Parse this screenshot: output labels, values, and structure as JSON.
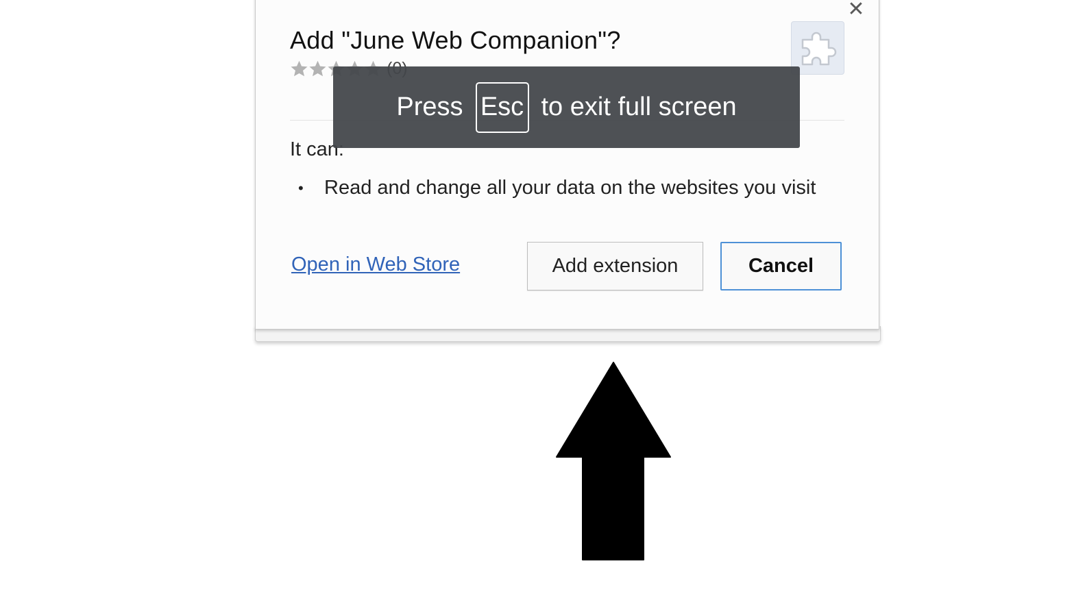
{
  "dialog": {
    "title": "Add \"June Web Companion\"?",
    "rating": {
      "stars_filled": 0,
      "stars_total": 5,
      "count_label": "(0)"
    },
    "icon": "puzzle-piece-icon",
    "close_icon": "close-icon",
    "close_glyph": "✕",
    "permissions_heading": "It can:",
    "permissions": [
      "Read and change all your data on the websites you visit"
    ],
    "bullet": "•",
    "webstore_link_label": "Open in Web Store",
    "add_button_label": "Add extension",
    "cancel_button_label": "Cancel"
  },
  "fullscreen_toast": {
    "prefix": "Press",
    "key": "Esc",
    "suffix": "to exit full screen"
  },
  "overlay": {
    "arrow_icon": "up-arrow-icon"
  },
  "colors": {
    "link": "#3063b8",
    "cancel_border": "#4d90d6",
    "toast_background": "#43464a"
  }
}
